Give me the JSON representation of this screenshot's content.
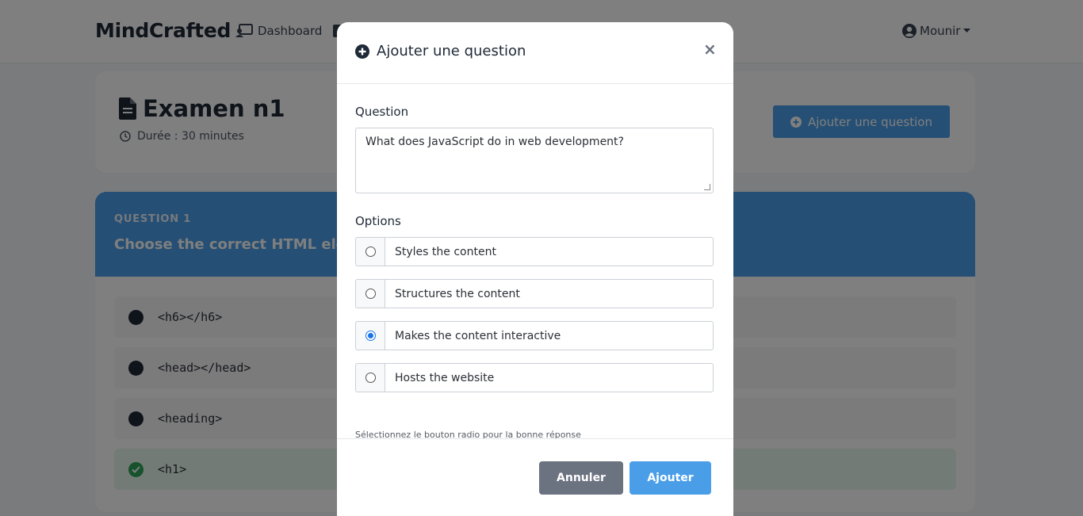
{
  "navbar": {
    "brand": "MindCrafted",
    "dashboard_label": "Dashboard",
    "user_name": "Mounir"
  },
  "exam": {
    "title": "Examen n1",
    "duration": "Durée : 30 minutes",
    "add_question_label": "Ajouter une question"
  },
  "question_card": {
    "number_label": "QUESTION 1",
    "text": "Choose the correct HTML element",
    "options": [
      {
        "text": "<h6></h6>",
        "correct": false
      },
      {
        "text": "<head></head>",
        "correct": false
      },
      {
        "text": "<heading>",
        "correct": false
      },
      {
        "text": "<h1>",
        "correct": true
      }
    ]
  },
  "modal": {
    "title": "Ajouter une question",
    "close_symbol": "×",
    "question_label": "Question",
    "question_value": "What does JavaScript do in web development?",
    "options_label": "Options",
    "options": [
      {
        "text": "Styles the content",
        "selected": false
      },
      {
        "text": "Structures the content",
        "selected": false
      },
      {
        "text": "Makes the content interactive",
        "selected": true
      },
      {
        "text": "Hosts the website",
        "selected": false
      }
    ],
    "help_text": "Sélectionnez le bouton radio pour la bonne réponse",
    "cancel_label": "Annuler",
    "submit_label": "Ajouter"
  },
  "colors": {
    "accent": "#4a9ee8",
    "cancel": "#6b7280",
    "correct": "#2ea45a",
    "backdrop": "rgba(0,0,0,0.5)"
  }
}
